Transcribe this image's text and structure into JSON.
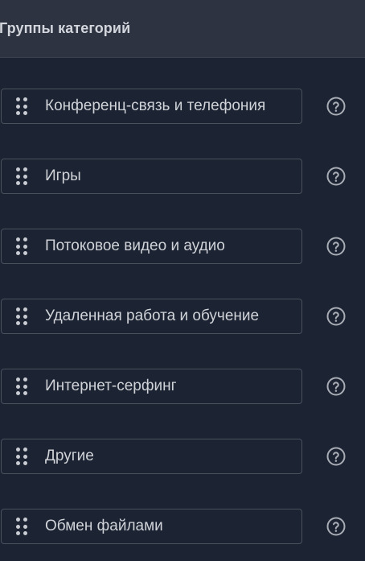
{
  "header": {
    "title": "Группы категорий"
  },
  "categories": [
    {
      "label": "Конференц-связь и телефония"
    },
    {
      "label": "Игры"
    },
    {
      "label": "Потоковое видео и аудио"
    },
    {
      "label": "Удаленная работа и обучение"
    },
    {
      "label": "Интернет-серфинг"
    },
    {
      "label": "Другие"
    },
    {
      "label": "Обмен файлами"
    }
  ],
  "icons": {
    "drag": "drag-handle-icon",
    "help": "help-circle-icon"
  },
  "colors": {
    "background": "#1c2333",
    "header_background": "#2d3340",
    "border": "#4a505c",
    "text": "#d0d3d8",
    "icon": "#a9adb5"
  }
}
